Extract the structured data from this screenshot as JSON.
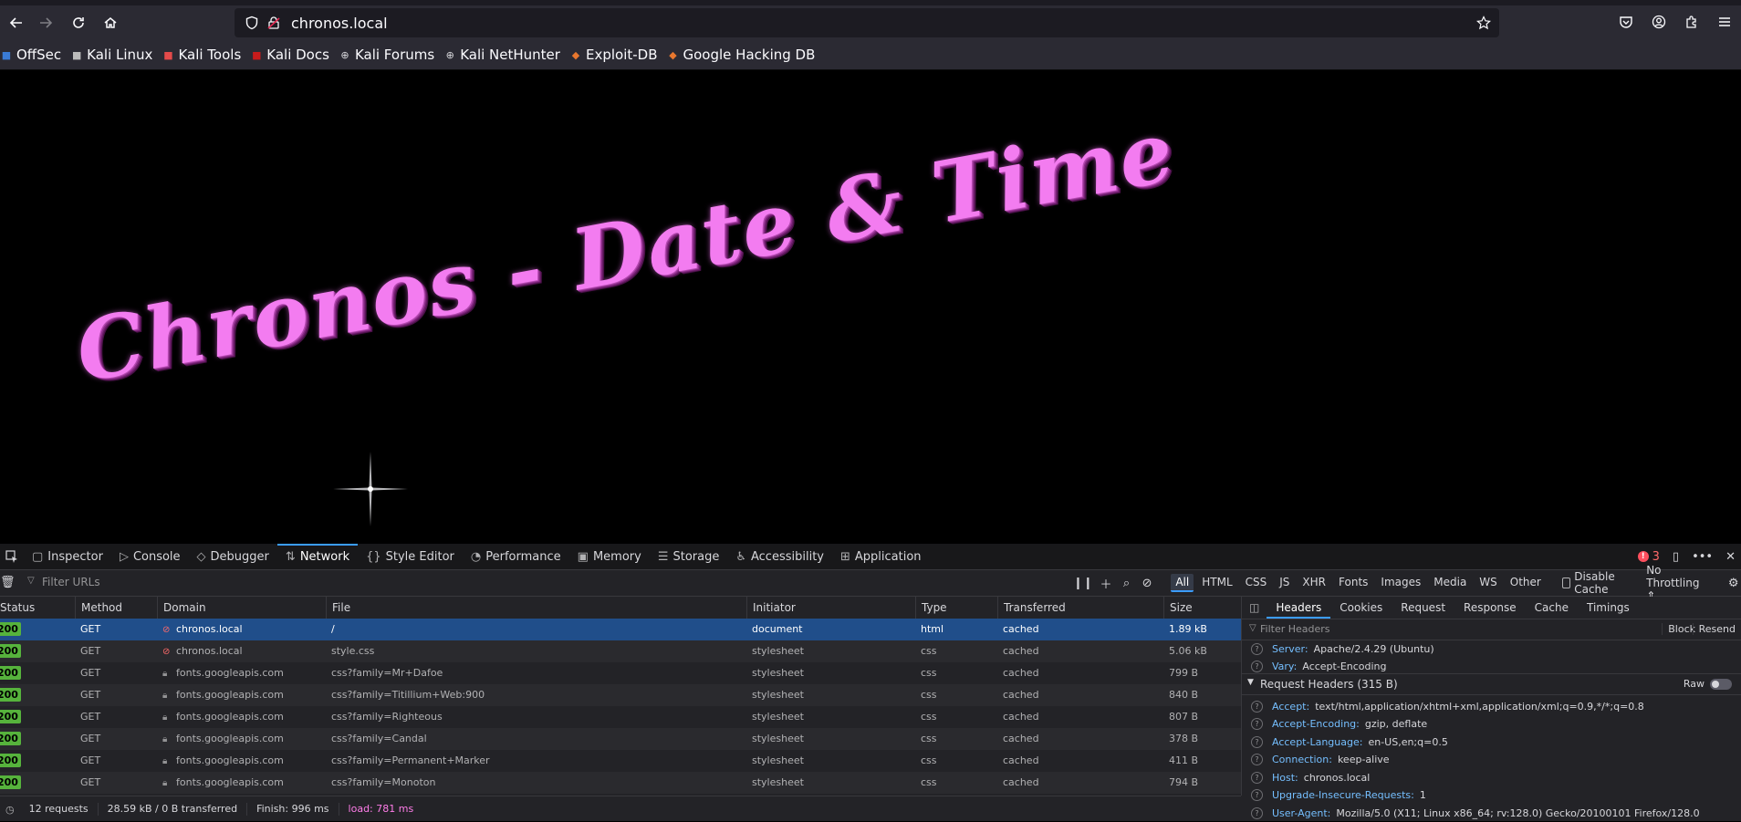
{
  "browser": {
    "url": "chronos.local",
    "bookmarks": [
      {
        "label": "OffSec",
        "icon": "offsec-icon",
        "color": "#3a7bd5"
      },
      {
        "label": "Kali Linux",
        "icon": "kali-icon",
        "color": "#bbbbbb"
      },
      {
        "label": "Kali Tools",
        "icon": "kali-tools-icon",
        "color": "#e44a4a"
      },
      {
        "label": "Kali Docs",
        "icon": "kali-docs-icon",
        "color": "#c61b1b"
      },
      {
        "label": "Kali Forums",
        "icon": "globe-icon",
        "color": "#d7d7db"
      },
      {
        "label": "Kali NetHunter",
        "icon": "globe-icon",
        "color": "#d7d7db"
      },
      {
        "label": "Exploit-DB",
        "icon": "exploitdb-icon",
        "color": "#e8772e"
      },
      {
        "label": "Google Hacking DB",
        "icon": "ghdb-icon",
        "color": "#e8772e"
      }
    ]
  },
  "page": {
    "title": "Chronos - Date & Time",
    "title_color": "#f37cf0"
  },
  "devtools": {
    "tabs": [
      {
        "label": "Inspector",
        "icon": "inspector-icon",
        "glyph": "▢"
      },
      {
        "label": "Console",
        "icon": "console-icon",
        "glyph": "▷"
      },
      {
        "label": "Debugger",
        "icon": "debugger-icon",
        "glyph": "◇"
      },
      {
        "label": "Network",
        "icon": "network-icon",
        "glyph": "⇅",
        "active": true
      },
      {
        "label": "Style Editor",
        "icon": "style-editor-icon",
        "glyph": "{}"
      },
      {
        "label": "Performance",
        "icon": "performance-icon",
        "glyph": "◔"
      },
      {
        "label": "Memory",
        "icon": "memory-icon",
        "glyph": "▣"
      },
      {
        "label": "Storage",
        "icon": "storage-icon",
        "glyph": "☰"
      },
      {
        "label": "Accessibility",
        "icon": "accessibility-icon",
        "glyph": "♿"
      },
      {
        "label": "Application",
        "icon": "application-icon",
        "glyph": "⊞"
      }
    ],
    "error_count": "3",
    "filter_placeholder": "Filter URLs",
    "filter_types": [
      "All",
      "HTML",
      "CSS",
      "JS",
      "XHR",
      "Fonts",
      "Images",
      "Media",
      "WS",
      "Other"
    ],
    "active_filter": "All",
    "disable_cache_label": "Disable Cache",
    "throttling_label": "No Throttling",
    "columns": [
      "Status",
      "Method",
      "Domain",
      "File",
      "Initiator",
      "Type",
      "Transferred",
      "Size"
    ],
    "requests": [
      {
        "status": "200",
        "method": "GET",
        "domain": "chronos.local",
        "file": "/",
        "initiator": "document",
        "type": "html",
        "transferred": "cached",
        "size": "1.89 kB",
        "selected": true,
        "secure": false
      },
      {
        "status": "200",
        "method": "GET",
        "domain": "chronos.local",
        "file": "style.css",
        "initiator": "stylesheet",
        "type": "css",
        "transferred": "cached",
        "size": "5.06 kB",
        "secure": false
      },
      {
        "status": "200",
        "method": "GET",
        "domain": "fonts.googleapis.com",
        "file": "css?family=Mr+Dafoe",
        "initiator": "stylesheet",
        "type": "css",
        "transferred": "cached",
        "size": "799 B",
        "secure": true
      },
      {
        "status": "200",
        "method": "GET",
        "domain": "fonts.googleapis.com",
        "file": "css?family=Titillium+Web:900",
        "initiator": "stylesheet",
        "type": "css",
        "transferred": "cached",
        "size": "840 B",
        "secure": true
      },
      {
        "status": "200",
        "method": "GET",
        "domain": "fonts.googleapis.com",
        "file": "css?family=Righteous",
        "initiator": "stylesheet",
        "type": "css",
        "transferred": "cached",
        "size": "807 B",
        "secure": true
      },
      {
        "status": "200",
        "method": "GET",
        "domain": "fonts.googleapis.com",
        "file": "css?family=Candal",
        "initiator": "stylesheet",
        "type": "css",
        "transferred": "cached",
        "size": "378 B",
        "secure": true
      },
      {
        "status": "200",
        "method": "GET",
        "domain": "fonts.googleapis.com",
        "file": "css?family=Permanent+Marker",
        "initiator": "stylesheet",
        "type": "css",
        "transferred": "cached",
        "size": "411 B",
        "secure": true
      },
      {
        "status": "200",
        "method": "GET",
        "domain": "fonts.googleapis.com",
        "file": "css?family=Monoton",
        "initiator": "stylesheet",
        "type": "css",
        "transferred": "cached",
        "size": "794 B",
        "secure": true
      }
    ],
    "summary": {
      "requests": "12 requests",
      "transferred": "28.59 kB / 0 B transferred",
      "finish": "Finish: 996 ms",
      "load": "load: 781 ms"
    },
    "side_tabs": [
      "Headers",
      "Cookies",
      "Request",
      "Response",
      "Cache",
      "Timings"
    ],
    "active_side_tab": "Headers",
    "filter_headers_placeholder": "Filter Headers",
    "block_label": "Block",
    "resend_label": "Resend",
    "response_headers_tail": [
      {
        "name": "Server:",
        "value": "Apache/2.4.29 (Ubuntu)"
      },
      {
        "name": "Vary:",
        "value": "Accept-Encoding"
      }
    ],
    "request_headers_title": "Request Headers (315 B)",
    "raw_label": "Raw",
    "request_headers": [
      {
        "name": "Accept:",
        "value": "text/html,application/xhtml+xml,application/xml;q=0.9,*/*;q=0.8"
      },
      {
        "name": "Accept-Encoding:",
        "value": "gzip, deflate"
      },
      {
        "name": "Accept-Language:",
        "value": "en-US,en;q=0.5"
      },
      {
        "name": "Connection:",
        "value": "keep-alive"
      },
      {
        "name": "Host:",
        "value": "chronos.local"
      },
      {
        "name": "Upgrade-Insecure-Requests:",
        "value": "1"
      },
      {
        "name": "User-Agent:",
        "value": "Mozilla/5.0 (X11; Linux x86_64; rv:128.0) Gecko/20100101 Firefox/128.0"
      }
    ]
  }
}
